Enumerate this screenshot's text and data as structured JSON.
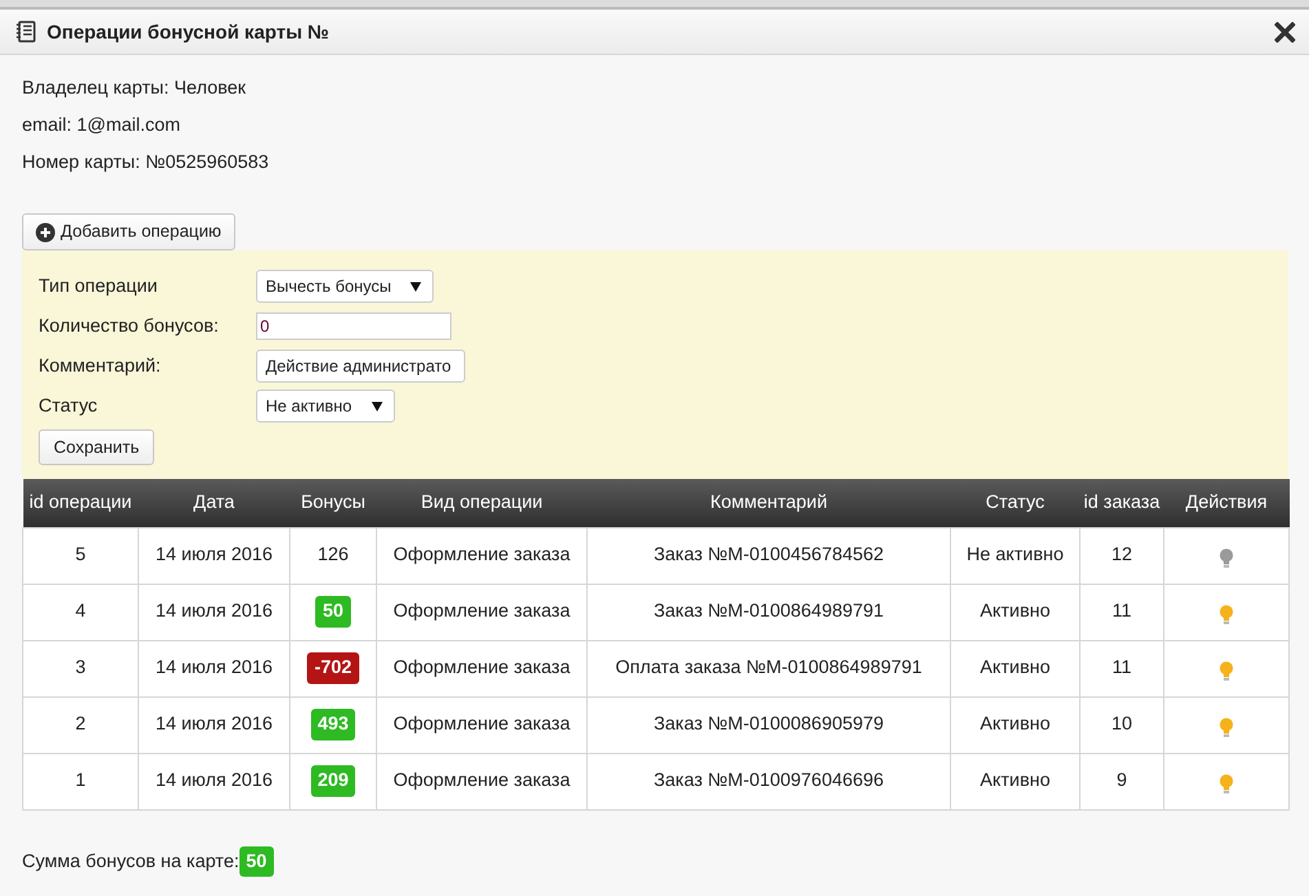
{
  "window": {
    "title": "Операции бонусной карты №"
  },
  "info": [
    "Владелец карты: Человек",
    "email: 1@mail.com",
    "Номер карты: №0525960583"
  ],
  "add_button": "Добавить операцию",
  "form": {
    "fields": [
      {
        "kind": "select",
        "label": "Тип операции",
        "value": "Вычесть бонусы"
      },
      {
        "kind": "input",
        "label": "Количество бонусов:",
        "value": "0"
      },
      {
        "kind": "input",
        "label": "Комментарий:",
        "value": "Действие администрато"
      },
      {
        "kind": "select",
        "label": "Статус",
        "value": "Не активно"
      }
    ],
    "save_button": "Сохранить"
  },
  "table": {
    "columns": [
      "id операции",
      "Дата",
      "Бонусы",
      "Вид операции",
      "Комментарий",
      "Статус",
      "id заказа",
      "Действия"
    ],
    "rows": [
      {
        "id": "5",
        "date": "14 июля 2016",
        "bonus": {
          "text": "126"
        },
        "type": "Оформление заказа",
        "comment": "Заказ №M-0100456784562",
        "status": "Не активно",
        "order": "12",
        "on": false
      },
      {
        "id": "4",
        "date": "14 июля 2016",
        "bonus": {
          "text": "50",
          "color": "#2dba22"
        },
        "type": "Оформление заказа",
        "comment": "Заказ №M-0100864989791",
        "status": "Активно",
        "order": "11",
        "on": true
      },
      {
        "id": "3",
        "date": "14 июля 2016",
        "bonus": {
          "text": "-702",
          "color": "#b51414"
        },
        "type": "Оформление заказа",
        "comment": "Оплата заказа №M-0100864989791",
        "status": "Активно",
        "order": "11",
        "on": true
      },
      {
        "id": "2",
        "date": "14 июля 2016",
        "bonus": {
          "text": "493",
          "color": "#2dba22"
        },
        "type": "Оформление заказа",
        "comment": "Заказ №M-0100086905979",
        "status": "Активно",
        "order": "10",
        "on": true
      },
      {
        "id": "1",
        "date": "14 июля 2016",
        "bonus": {
          "text": "209",
          "color": "#2dba22"
        },
        "type": "Оформление заказа",
        "comment": "Заказ №M-0100976046696",
        "status": "Активно",
        "order": "9",
        "on": true
      }
    ]
  },
  "total": {
    "label": "Сумма бонусов на карте:",
    "value": "50"
  }
}
